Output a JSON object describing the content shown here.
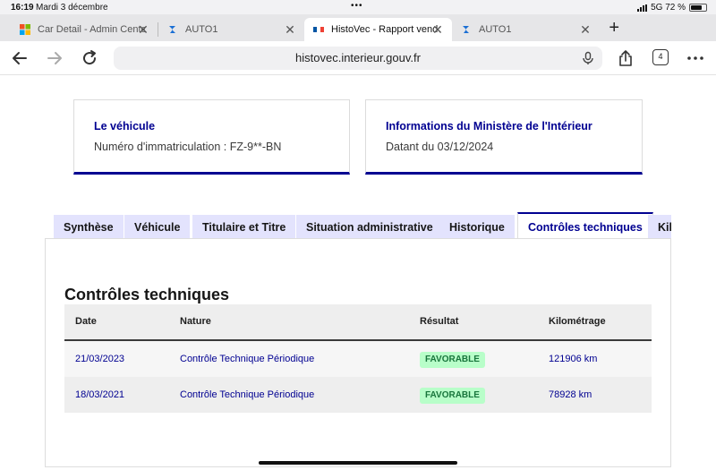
{
  "statusbar": {
    "time": "16:19",
    "date": "Mardi 3 décembre",
    "dots": "•••",
    "network": "5G 72 %"
  },
  "browser": {
    "tabs": [
      {
        "title": "Car Detail - Admin Center",
        "favicon": "grid-icon"
      },
      {
        "title": "AUTO1",
        "favicon": "auto1-icon"
      },
      {
        "title": "HistoVec - Rapport vendeur",
        "favicon": "flag-fr-icon"
      },
      {
        "title": "AUTO1",
        "favicon": "auto1-icon"
      }
    ],
    "url": "histovec.interieur.gouv.fr",
    "tab_count": "4"
  },
  "cards": {
    "vehicle": {
      "title": "Le véhicule",
      "text": "Numéro d'immatriculation : FZ-9**-BN"
    },
    "ministry": {
      "title": "Informations du Ministère de l'Intérieur",
      "text": "Datant du 03/12/2024"
    }
  },
  "page_tabs": [
    "Synthèse",
    "Véhicule",
    "Titulaire et Titre",
    "Situation administrative",
    "Historique",
    "Contrôles techniques",
    "Kilométrage"
  ],
  "section": {
    "title": "Contrôles techniques",
    "columns": [
      "Date",
      "Nature",
      "Résultat",
      "Kilométrage"
    ],
    "rows": [
      {
        "date": "21/03/2023",
        "nature": "Contrôle Technique Périodique",
        "result": "FAVORABLE",
        "km": "121906 km"
      },
      {
        "date": "18/03/2021",
        "nature": "Contrôle Technique Périodique",
        "result": "FAVORABLE",
        "km": "78928 km"
      }
    ]
  },
  "colors": {
    "accent": "#000091",
    "tab_bg": "#e3e3fd",
    "badge_bg": "#b8fec9",
    "badge_text": "#18753c"
  }
}
